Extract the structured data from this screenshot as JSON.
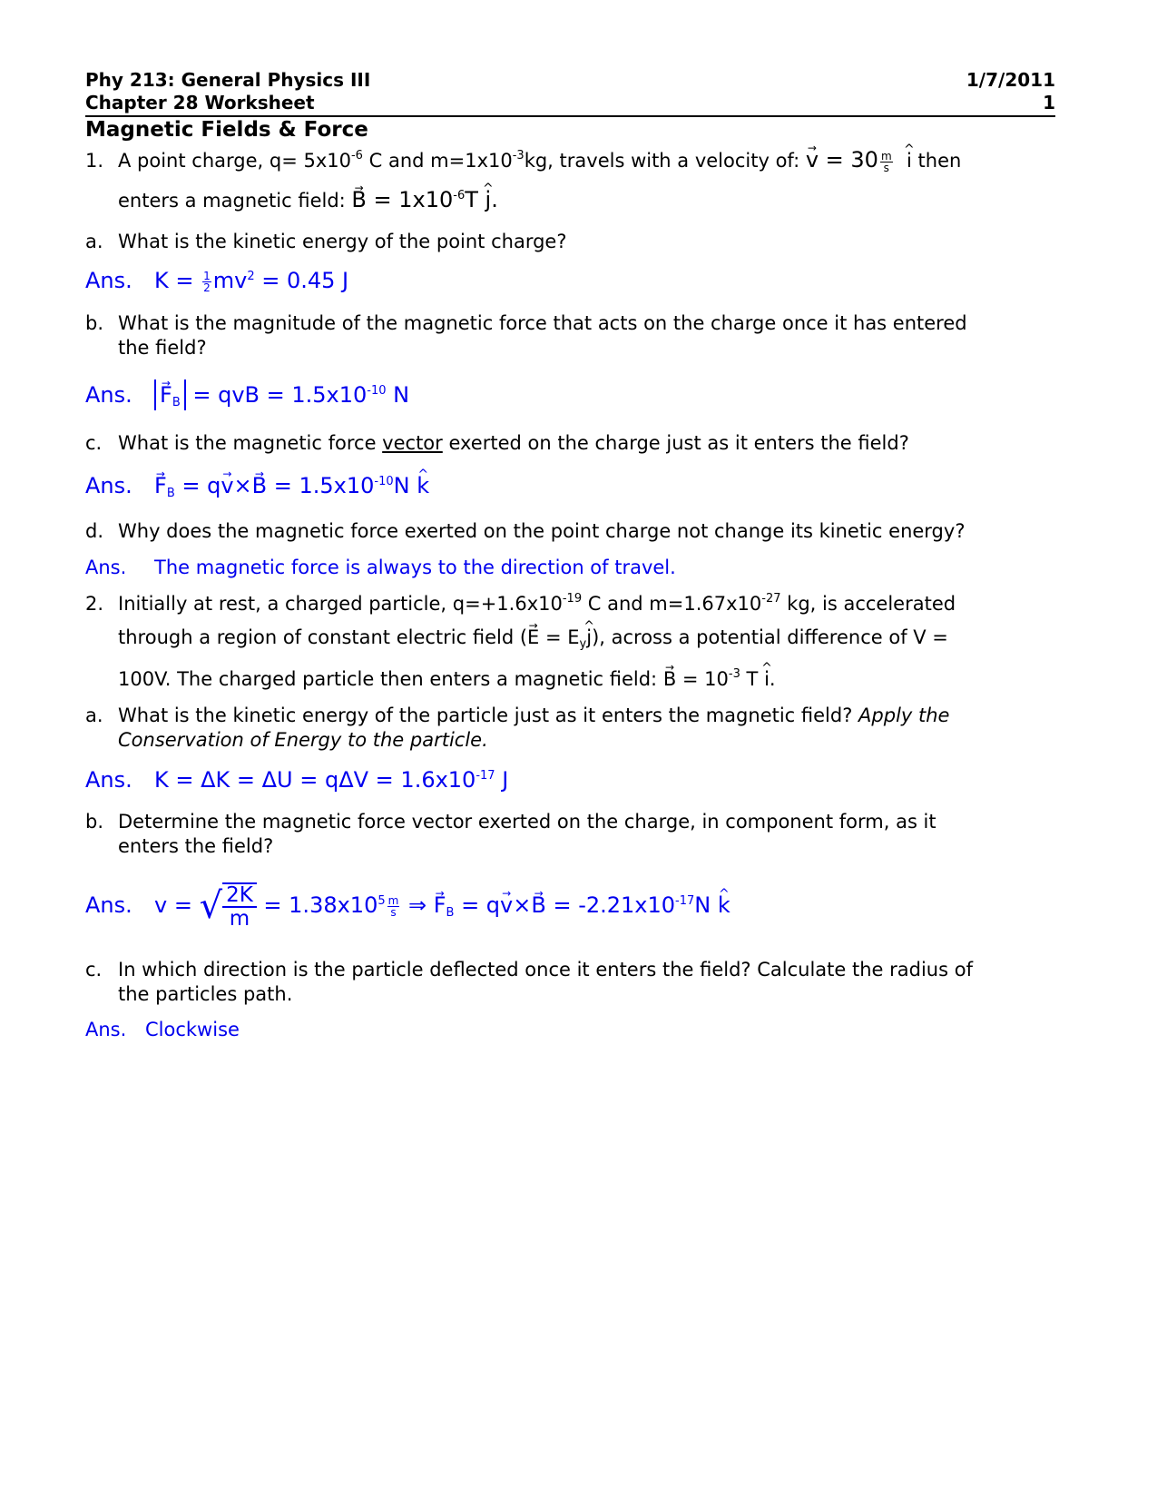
{
  "header": {
    "course": "Phy 213:  General Physics III",
    "date": "1/7/2011",
    "worksheet": "Chapter 28 Worksheet",
    "page_number": "1"
  },
  "title": "Magnetic Fields & Force",
  "answer_color": "#0000ee",
  "problem1": {
    "number": "1.",
    "text_a": "A point charge, q= 5x10",
    "q_exp": "-6",
    "text_b": " C and m=1x10",
    "m_exp": "-3",
    "text_c": "kg, travels with a velocity of: ",
    "v_sym": "v",
    "v_eq": " = 30",
    "v_unit_num": "m",
    "v_unit_den": "s",
    "v_dir": "i",
    "text_d": " then",
    "line2_a": "enters a magnetic field: ",
    "b_sym": "B",
    "b_eq": " = 1x10",
    "b_exp": "-6",
    "b_unit": "T ",
    "b_dir": "j",
    "b_end": ".",
    "parts": {
      "a": {
        "label": "a.",
        "question": "What is the kinetic energy of the point charge?",
        "ans_label": "Ans.",
        "ans_k": "K = ",
        "ans_half_num": "1",
        "ans_half_den": "2",
        "ans_mv": "mv",
        "ans_exp": "2",
        "ans_result": " = 0.45 J"
      },
      "b": {
        "label": "b.",
        "question_line1": "What is the magnitude of the magnetic force that acts on the charge once it has entered",
        "question_line2": "the field?",
        "ans_label": "Ans.",
        "ans_F": "F",
        "ans_sub": "B",
        "ans_eq": " = qvB = 1.5x10",
        "ans_exp": "-10",
        "ans_unit": " N"
      },
      "c": {
        "label": "c.",
        "question_a": "What is the magnetic force ",
        "question_underlined": "vector",
        "question_b": " exerted on the charge just as it enters the field?",
        "ans_label": "Ans.",
        "ans_F": "F",
        "ans_sub": "B",
        "ans_eq1": " = q",
        "ans_v": "v",
        "ans_cross": "×",
        "ans_B": "B",
        "ans_eq2": " = 1.5x10",
        "ans_exp": "-10",
        "ans_unit": "N ",
        "ans_dir": "k"
      },
      "d": {
        "label": "d.",
        "question": "Why does the magnetic force exerted on the point charge not change its kinetic energy?",
        "ans_label": "Ans.",
        "answer": "The magnetic force is always to the direction of travel."
      }
    }
  },
  "problem2": {
    "number": "2.",
    "l1_a": "Initially at rest, a charged particle, q=+1.6x10",
    "q_exp": "-19",
    "l1_b": " C and m=1.67x10",
    "m_exp": "-27",
    "l1_c": " kg, is accelerated",
    "l2_a": "through a region of constant electric field (",
    "e_sym": "E",
    "l2_b": " = E",
    "e_sub": "y",
    "e_dir": "j",
    "l2_c": "), across a potential difference of V =",
    "l3_a": "100V.  The charged particle then enters a magnetic field: ",
    "b_sym": "B",
    "l3_b": " = 10",
    "b_exp": "-3",
    "l3_c": " T ",
    "b_dir": "i",
    "l3_d": ".",
    "parts": {
      "a": {
        "label": "a.",
        "question_line1": "What is the kinetic energy of the particle just as it enters the magnetic field?  ",
        "question_italic1": "Apply the",
        "question_italic2": "Conservation of Energy to the particle.",
        "ans_label": "Ans.",
        "ans_text": "K = ΔK = ΔU = qΔV = 1.6x10",
        "ans_exp": "-17",
        "ans_unit": " J"
      },
      "b": {
        "label": "b.",
        "question_line1": "Determine the magnetic force vector exerted on the charge, in component form, as it",
        "question_line2": "enters the field?",
        "ans_label": "Ans.",
        "ans_v": "v = ",
        "sqrt_num": "2K",
        "sqrt_den": "m",
        "ans_eq1": " = 1.38x10",
        "ans_exp1": "5",
        "unit_num": "m",
        "unit_den": "s",
        "implies": " ⇒ ",
        "ans_F": "F",
        "ans_sub": "B",
        "ans_eq2": " = q",
        "ans_vv": "v",
        "ans_cross": "×",
        "ans_B": "B",
        "ans_eq3": " = -2.21x10",
        "ans_exp2": "-17",
        "ans_unit": "N ",
        "ans_dir": "k"
      },
      "c": {
        "label": "c.",
        "question_line1": "In which direction is the particle deflected once it enters the field?  Calculate the radius of",
        "question_line2": "the particles path.",
        "ans_label": "Ans.",
        "answer": "Clockwise"
      }
    }
  }
}
